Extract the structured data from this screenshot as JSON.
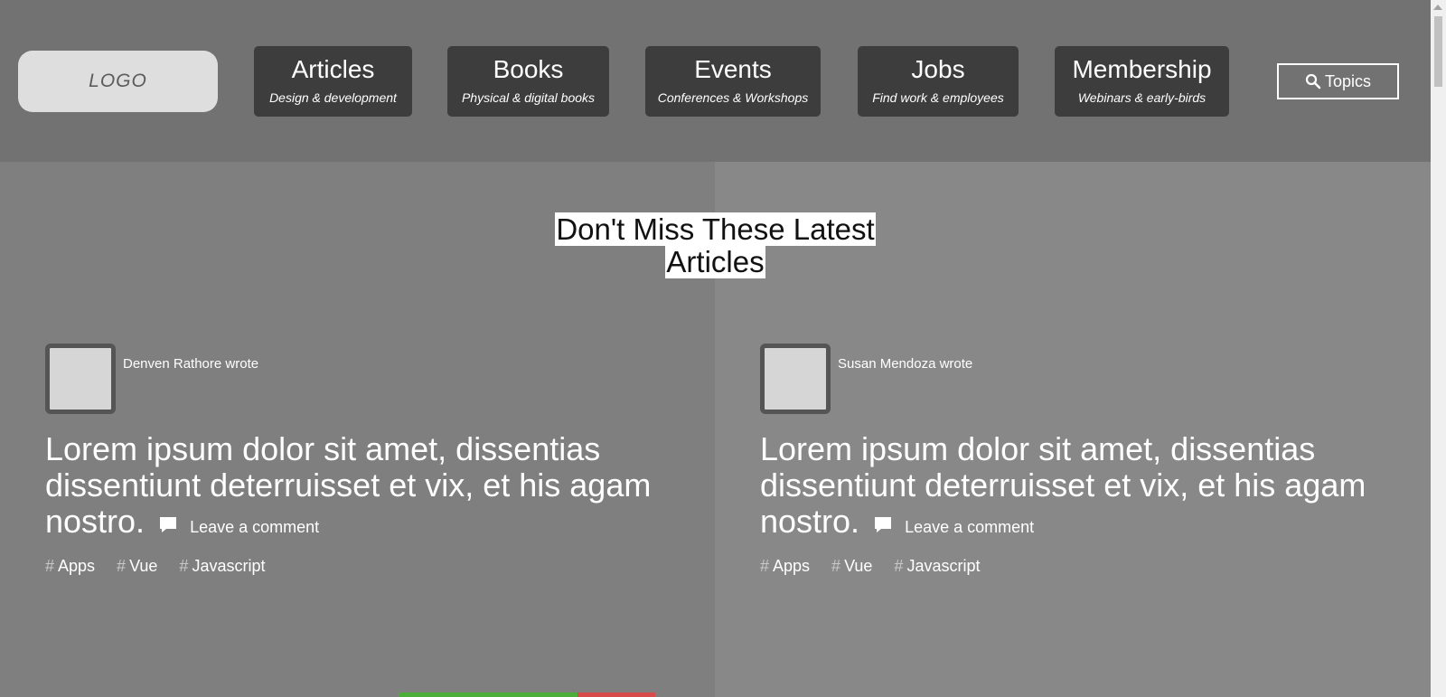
{
  "header": {
    "logo": "LOGO",
    "nav": [
      {
        "title": "Articles",
        "subtitle": "Design & development"
      },
      {
        "title": "Books",
        "subtitle": "Physical & digital books"
      },
      {
        "title": "Events",
        "subtitle": "Conferences & Workshops"
      },
      {
        "title": "Jobs",
        "subtitle": "Find work & employees"
      },
      {
        "title": "Membership",
        "subtitle": "Webinars & early-birds"
      }
    ],
    "topics_label": "Topics"
  },
  "main": {
    "section_title_line1": "Don't Miss These Latest",
    "section_title_line2": "Articles",
    "posts": [
      {
        "author": "Denven Rathore wrote",
        "title": "Lorem ipsum dolor sit amet, dissentias dissentiunt deterruisset et vix, et his agam nostro.",
        "comment": "Leave a comment",
        "tags": [
          "Apps",
          "Vue",
          "Javascript"
        ]
      },
      {
        "author": "Susan Mendoza wrote",
        "title": "Lorem ipsum dolor sit amet, dissentias dissentiunt deterruisset et vix, et his agam nostro.",
        "comment": "Leave a comment",
        "tags": [
          "Apps",
          "Vue",
          "Javascript"
        ]
      }
    ]
  },
  "icons": {
    "search": "search-icon",
    "comment": "comment-icon"
  }
}
